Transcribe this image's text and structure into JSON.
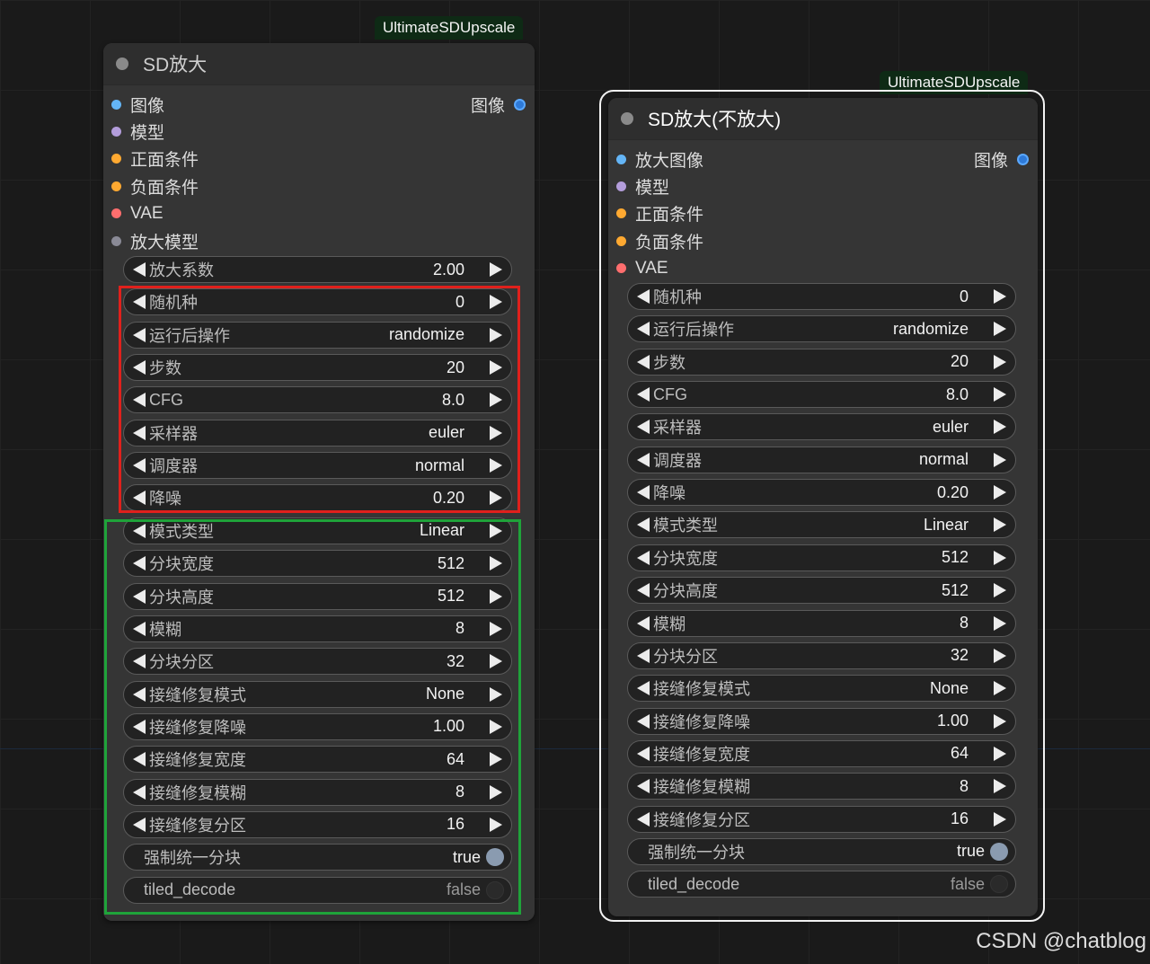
{
  "left_node": {
    "badge": "UltimateSDUpscale",
    "title": "SD放大",
    "inputs": [
      {
        "label": "图像",
        "color": "#64b5f6"
      },
      {
        "label": "模型",
        "color": "#b39ddb"
      },
      {
        "label": "正面条件",
        "color": "#ffa931"
      },
      {
        "label": "负面条件",
        "color": "#ffa931"
      },
      {
        "label": "VAE",
        "color": "#ff6e6e"
      },
      {
        "label": "放大模型",
        "color": "#8a8a96"
      }
    ],
    "output": {
      "label": "图像",
      "color": "#2e7ad8"
    },
    "widgets": [
      {
        "label": "放大系数",
        "value": "2.00"
      },
      {
        "label": "随机种",
        "value": "0"
      },
      {
        "label": "运行后操作",
        "value": "randomize"
      },
      {
        "label": "步数",
        "value": "20"
      },
      {
        "label": "CFG",
        "value": "8.0"
      },
      {
        "label": "采样器",
        "value": "euler"
      },
      {
        "label": "调度器",
        "value": "normal"
      },
      {
        "label": "降噪",
        "value": "0.20"
      },
      {
        "label": "模式类型",
        "value": "Linear"
      },
      {
        "label": "分块宽度",
        "value": "512"
      },
      {
        "label": "分块高度",
        "value": "512"
      },
      {
        "label": "模糊",
        "value": "8"
      },
      {
        "label": "分块分区",
        "value": "32"
      },
      {
        "label": "接缝修复模式",
        "value": "None"
      },
      {
        "label": "接缝修复降噪",
        "value": "1.00"
      },
      {
        "label": "接缝修复宽度",
        "value": "64"
      },
      {
        "label": "接缝修复模糊",
        "value": "8"
      },
      {
        "label": "接缝修复分区",
        "value": "16"
      }
    ],
    "toggles": [
      {
        "label": "强制统一分块",
        "value": "true",
        "on": true
      },
      {
        "label": "tiled_decode",
        "value": "false",
        "on": false
      }
    ]
  },
  "right_node": {
    "badge": "UltimateSDUpscale",
    "title": "SD放大(不放大)",
    "inputs": [
      {
        "label": "放大图像",
        "color": "#64b5f6"
      },
      {
        "label": "模型",
        "color": "#b39ddb"
      },
      {
        "label": "正面条件",
        "color": "#ffa931"
      },
      {
        "label": "负面条件",
        "color": "#ffa931"
      },
      {
        "label": "VAE",
        "color": "#ff6e6e"
      }
    ],
    "output": {
      "label": "图像",
      "color": "#2e7ad8"
    },
    "widgets": [
      {
        "label": "随机种",
        "value": "0"
      },
      {
        "label": "运行后操作",
        "value": "randomize"
      },
      {
        "label": "步数",
        "value": "20"
      },
      {
        "label": "CFG",
        "value": "8.0"
      },
      {
        "label": "采样器",
        "value": "euler"
      },
      {
        "label": "调度器",
        "value": "normal"
      },
      {
        "label": "降噪",
        "value": "0.20"
      },
      {
        "label": "模式类型",
        "value": "Linear"
      },
      {
        "label": "分块宽度",
        "value": "512"
      },
      {
        "label": "分块高度",
        "value": "512"
      },
      {
        "label": "模糊",
        "value": "8"
      },
      {
        "label": "分块分区",
        "value": "32"
      },
      {
        "label": "接缝修复模式",
        "value": "None"
      },
      {
        "label": "接缝修复降噪",
        "value": "1.00"
      },
      {
        "label": "接缝修复宽度",
        "value": "64"
      },
      {
        "label": "接缝修复模糊",
        "value": "8"
      },
      {
        "label": "接缝修复分区",
        "value": "16"
      }
    ],
    "toggles": [
      {
        "label": "强制统一分块",
        "value": "true",
        "on": true
      },
      {
        "label": "tiled_decode",
        "value": "false",
        "on": false
      }
    ]
  },
  "watermark": "CSDN @chatblog"
}
